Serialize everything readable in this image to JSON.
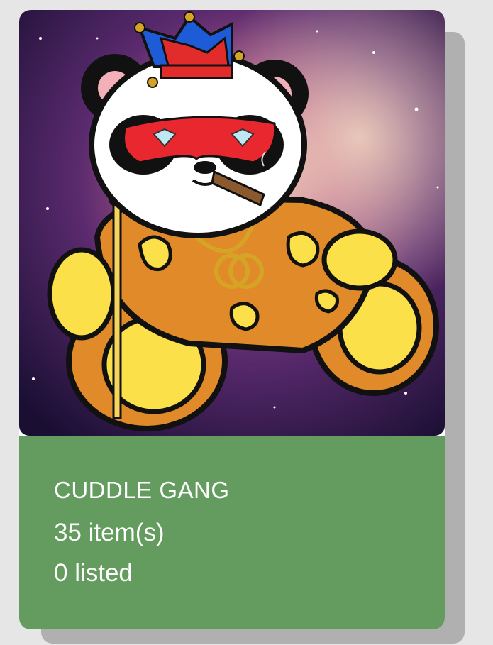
{
  "collection": {
    "name": "CUDDLE GANG",
    "items_text": "35 item(s)",
    "listed_text": "0 listed"
  },
  "colors": {
    "page_background": "#e6e6e6",
    "shadow": "#b0b0b0",
    "info_panel": "#639c5e",
    "info_text": "#ffffff"
  },
  "artwork": {
    "icon": "cuddle-gang-panda-nft-image"
  }
}
